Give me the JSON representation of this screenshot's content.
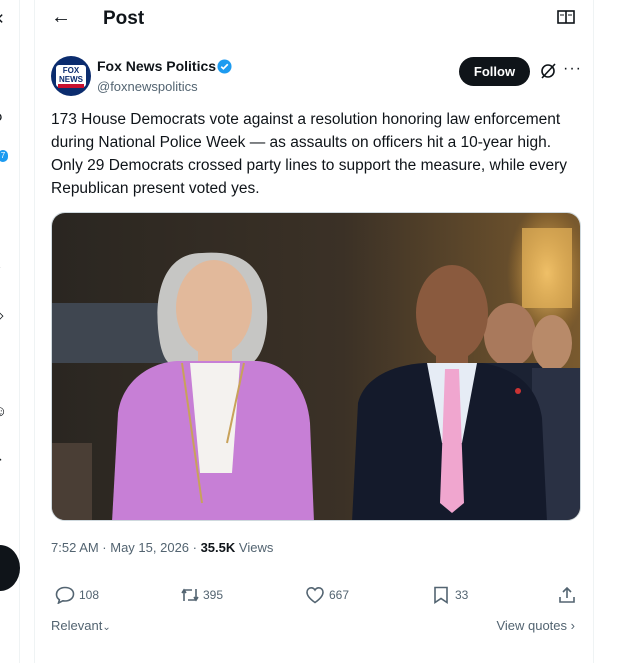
{
  "header": {
    "title": "Post"
  },
  "author": {
    "name": "Fox News Politics",
    "handle": "@foxnewspolitics",
    "avatar_text": "FOX NEWS"
  },
  "follow_label": "Follow",
  "post": {
    "text": "173 House Democrats vote against a resolution honoring law enforcement during National Police Week — as assaults on officers hit a 10-year high. Only 29 Democrats crossed party lines to support the measure, while every Republican present voted yes."
  },
  "meta": {
    "time": "7:52 AM · May 15, 2026 · ",
    "views_count": "35.5K",
    "views_label": " Views"
  },
  "stats": {
    "replies": "108",
    "reposts": "395",
    "likes": "667",
    "bookmarks": "33"
  },
  "footer": {
    "relevant": "Relevant",
    "view_quotes": "View quotes"
  },
  "sidebar": {
    "badge": "7"
  },
  "colors": {
    "accent": "#1d9bf0",
    "text": "#0f1419",
    "muted": "#536471"
  }
}
